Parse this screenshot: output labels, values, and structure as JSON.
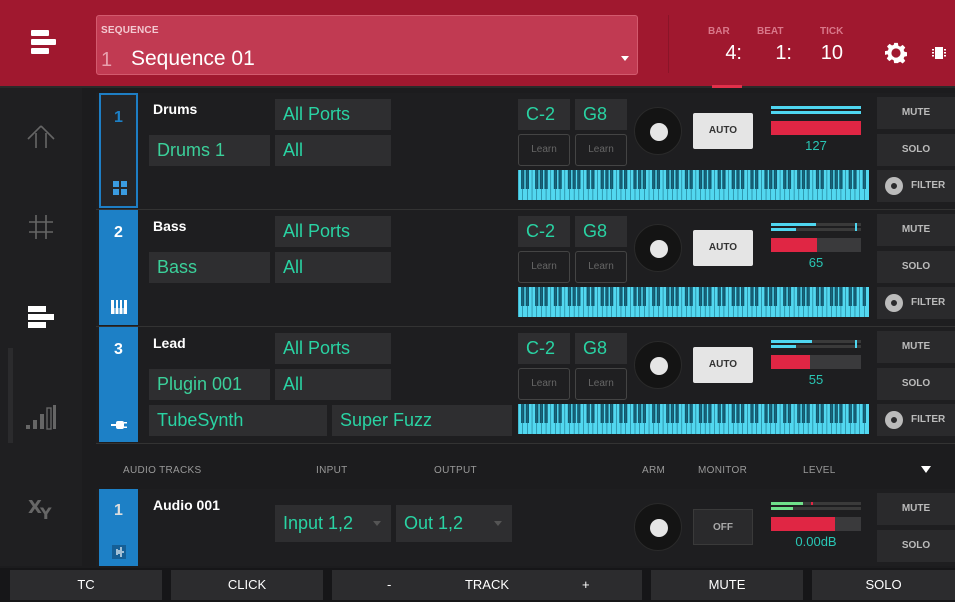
{
  "header": {
    "sequence_label": "SEQUENCE",
    "sequence_number": "1",
    "sequence_name": "Sequence 01",
    "bar_label": "BAR",
    "beat_label": "BEAT",
    "tick_label": "TICK",
    "bar_value": "4:",
    "beat_value": "1:",
    "tick_value": "10",
    "menu_icon": "track-view-icon",
    "settings_icon": "gear-icon",
    "device_icon": "chip-icon"
  },
  "nav": {
    "items": [
      {
        "name": "main",
        "icon": "up-arrow-icon"
      },
      {
        "name": "grid",
        "icon": "grid-icon"
      },
      {
        "name": "tracks",
        "icon": "track-view-icon"
      },
      {
        "name": "mixer",
        "icon": "level-bars-icon"
      },
      {
        "name": "xy",
        "icon": "xy-fx-icon"
      }
    ]
  },
  "tracks": [
    {
      "number": "1",
      "name": "Drums",
      "input_port": "All Ports",
      "program": "Drums 1",
      "channel": "All",
      "low_note": "C-2",
      "high_note": "G8",
      "learn_low": "Learn",
      "learn_high": "Learn",
      "auto_label": "AUTO",
      "level": "127",
      "level_fraction": 1.0,
      "meter_top": 1.0,
      "meter_bottom": 1.0,
      "mute": "MUTE",
      "solo": "SOLO",
      "filter": "FILTER",
      "type_icon": "drum-grid-icon"
    },
    {
      "number": "2",
      "name": "Bass",
      "input_port": "All Ports",
      "program": "Bass",
      "channel": "All",
      "low_note": "C-2",
      "high_note": "G8",
      "learn_low": "Learn",
      "learn_high": "Learn",
      "auto_label": "AUTO",
      "level": "65",
      "level_fraction": 0.51,
      "meter_top": 0.5,
      "meter_bottom": 0.28,
      "mute": "MUTE",
      "solo": "SOLO",
      "filter": "FILTER",
      "type_icon": "keys-icon"
    },
    {
      "number": "3",
      "name": "Lead",
      "input_port": "All Ports",
      "program": "Plugin 001",
      "channel": "All",
      "plugin": "TubeSynth",
      "preset": "Super Fuzz",
      "low_note": "C-2",
      "high_note": "G8",
      "learn_low": "Learn",
      "learn_high": "Learn",
      "auto_label": "AUTO",
      "level": "55",
      "level_fraction": 0.43,
      "meter_top": 0.46,
      "meter_bottom": 0.28,
      "mute": "MUTE",
      "solo": "SOLO",
      "filter": "FILTER",
      "type_icon": "plug-icon"
    }
  ],
  "audio": {
    "headers": {
      "tracks": "AUDIO TRACKS",
      "input": "INPUT",
      "output": "OUTPUT",
      "arm": "ARM",
      "monitor": "MONITOR",
      "level": "LEVEL"
    },
    "track": {
      "number": "1",
      "name": "Audio 001",
      "input": "Input 1,2",
      "output": "Out 1,2",
      "monitor": "OFF",
      "level": "0.00dB",
      "level_fraction": 0.71,
      "meter_top": 0.36,
      "meter_bottom": 0.24,
      "mute": "MUTE",
      "solo": "SOLO",
      "type_icon": "waveform-icon"
    }
  },
  "bottom": {
    "tc": "TC",
    "click": "CLICK",
    "minus": "-",
    "track": "TRACK",
    "plus": "+",
    "mute": "MUTE",
    "solo": "SOLO"
  },
  "colors": {
    "header_bg": "#a0182f",
    "accent_blue": "#1d80c6",
    "text_green": "#29d3a3",
    "meter_cyan": "#4fd6f0",
    "level_red": "#e02644",
    "keyboard": "#52d8f0"
  }
}
